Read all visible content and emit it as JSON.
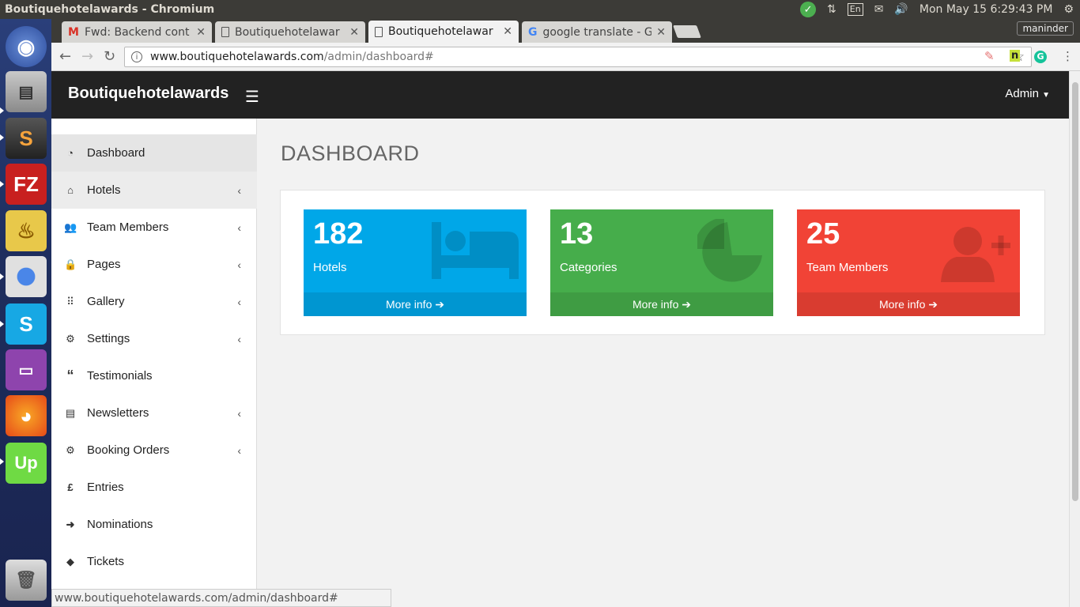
{
  "window": {
    "title": "Boutiquehotelawards - Chromium"
  },
  "tray": {
    "lang": "En",
    "clock": "Mon May 15  6:29:43 PM"
  },
  "browser": {
    "tabs": [
      {
        "label": "Fwd: Backend cont",
        "icon": "gmail-icon"
      },
      {
        "label": "Boutiquehotelawar",
        "icon": "document-icon"
      },
      {
        "label": "Boutiquehotelawar",
        "icon": "document-icon",
        "active": true
      },
      {
        "label": "google translate - G",
        "icon": "google-icon"
      }
    ],
    "profile": "maninder",
    "url_host": "www.boutiquehotelawards.com",
    "url_path": "/admin/dashboard#",
    "status_url": "www.boutiquehotelawards.com/admin/dashboard#"
  },
  "header": {
    "brand": "Boutiquehotelawards",
    "user_menu": "Admin"
  },
  "sidebar": {
    "items": [
      {
        "label": "Dashboard",
        "icon": "dashboard-icon"
      },
      {
        "label": "Hotels",
        "icon": "home-icon"
      },
      {
        "label": "Team Members",
        "icon": "users-icon"
      },
      {
        "label": "Pages",
        "icon": "lock-icon"
      },
      {
        "label": "Gallery",
        "icon": "grid-icon"
      },
      {
        "label": "Settings",
        "icon": "gears-icon"
      },
      {
        "label": "Testimonials",
        "icon": "quote-icon"
      },
      {
        "label": "Newsletters",
        "icon": "newspaper-icon"
      },
      {
        "label": "Booking Orders",
        "icon": "gears-icon"
      },
      {
        "label": "Entries",
        "icon": "pound-icon"
      },
      {
        "label": "Nominations",
        "icon": "arrow-right-icon"
      },
      {
        "label": "Tickets",
        "icon": "ticket-icon"
      }
    ]
  },
  "main": {
    "title": "DASHBOARD",
    "boxes": [
      {
        "number": "182",
        "label": "Hotels",
        "footer": "More info",
        "color": "#00a7e8",
        "footer_color": "#0096d1",
        "icon": "bed-icon"
      },
      {
        "number": "13",
        "label": "Categories",
        "footer": "More info",
        "color": "#46ad4b",
        "footer_color": "#3f9c43",
        "icon": "pie-chart-icon"
      },
      {
        "number": "25",
        "label": "Team Members",
        "footer": "More info",
        "color": "#f14336",
        "footer_color": "#d93c30",
        "icon": "user-plus-icon"
      }
    ]
  }
}
